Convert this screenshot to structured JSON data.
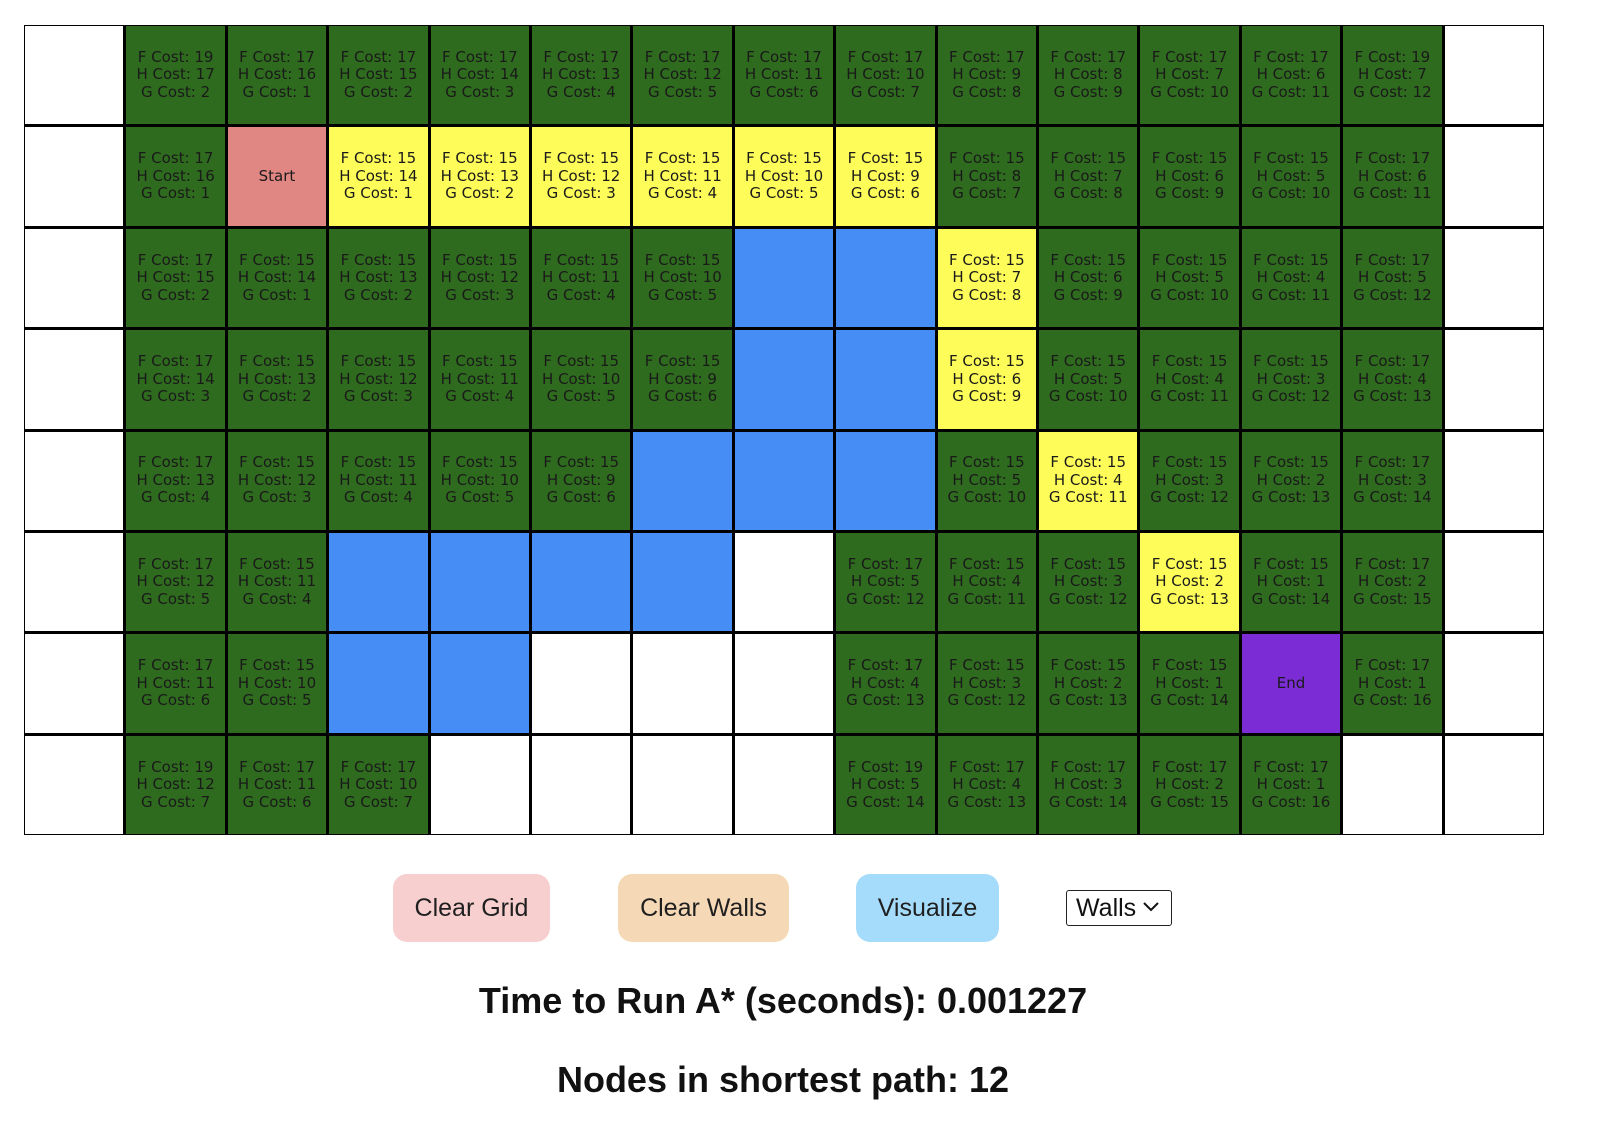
{
  "grid": {
    "rows": [
      [
        {
          "type": "empty"
        },
        {
          "type": "visited",
          "f": 19,
          "h": 17,
          "g": 2
        },
        {
          "type": "visited",
          "f": 17,
          "h": 16,
          "g": 1
        },
        {
          "type": "visited",
          "f": 17,
          "h": 15,
          "g": 2
        },
        {
          "type": "visited",
          "f": 17,
          "h": 14,
          "g": 3
        },
        {
          "type": "visited",
          "f": 17,
          "h": 13,
          "g": 4
        },
        {
          "type": "visited",
          "f": 17,
          "h": 12,
          "g": 5
        },
        {
          "type": "visited",
          "f": 17,
          "h": 11,
          "g": 6
        },
        {
          "type": "visited",
          "f": 17,
          "h": 10,
          "g": 7
        },
        {
          "type": "visited",
          "f": 17,
          "h": 9,
          "g": 8
        },
        {
          "type": "visited",
          "f": 17,
          "h": 8,
          "g": 9
        },
        {
          "type": "visited",
          "f": 17,
          "h": 7,
          "g": 10
        },
        {
          "type": "visited",
          "f": 17,
          "h": 6,
          "g": 11
        },
        {
          "type": "visited",
          "f": 19,
          "h": 7,
          "g": 12
        },
        {
          "type": "empty"
        }
      ],
      [
        {
          "type": "empty"
        },
        {
          "type": "visited",
          "f": 17,
          "h": 16,
          "g": 1
        },
        {
          "type": "start",
          "label": "Start"
        },
        {
          "type": "path",
          "f": 15,
          "h": 14,
          "g": 1
        },
        {
          "type": "path",
          "f": 15,
          "h": 13,
          "g": 2
        },
        {
          "type": "path",
          "f": 15,
          "h": 12,
          "g": 3
        },
        {
          "type": "path",
          "f": 15,
          "h": 11,
          "g": 4
        },
        {
          "type": "path",
          "f": 15,
          "h": 10,
          "g": 5
        },
        {
          "type": "path",
          "f": 15,
          "h": 9,
          "g": 6
        },
        {
          "type": "visited",
          "f": 15,
          "h": 8,
          "g": 7
        },
        {
          "type": "visited",
          "f": 15,
          "h": 7,
          "g": 8
        },
        {
          "type": "visited",
          "f": 15,
          "h": 6,
          "g": 9
        },
        {
          "type": "visited",
          "f": 15,
          "h": 5,
          "g": 10
        },
        {
          "type": "visited",
          "f": 17,
          "h": 6,
          "g": 11
        },
        {
          "type": "empty"
        }
      ],
      [
        {
          "type": "empty"
        },
        {
          "type": "visited",
          "f": 17,
          "h": 15,
          "g": 2
        },
        {
          "type": "visited",
          "f": 15,
          "h": 14,
          "g": 1
        },
        {
          "type": "visited",
          "f": 15,
          "h": 13,
          "g": 2
        },
        {
          "type": "visited",
          "f": 15,
          "h": 12,
          "g": 3
        },
        {
          "type": "visited",
          "f": 15,
          "h": 11,
          "g": 4
        },
        {
          "type": "visited",
          "f": 15,
          "h": 10,
          "g": 5
        },
        {
          "type": "wall"
        },
        {
          "type": "wall"
        },
        {
          "type": "path",
          "f": 15,
          "h": 7,
          "g": 8
        },
        {
          "type": "visited",
          "f": 15,
          "h": 6,
          "g": 9
        },
        {
          "type": "visited",
          "f": 15,
          "h": 5,
          "g": 10
        },
        {
          "type": "visited",
          "f": 15,
          "h": 4,
          "g": 11
        },
        {
          "type": "visited",
          "f": 17,
          "h": 5,
          "g": 12
        },
        {
          "type": "empty"
        }
      ],
      [
        {
          "type": "empty"
        },
        {
          "type": "visited",
          "f": 17,
          "h": 14,
          "g": 3
        },
        {
          "type": "visited",
          "f": 15,
          "h": 13,
          "g": 2
        },
        {
          "type": "visited",
          "f": 15,
          "h": 12,
          "g": 3
        },
        {
          "type": "visited",
          "f": 15,
          "h": 11,
          "g": 4
        },
        {
          "type": "visited",
          "f": 15,
          "h": 10,
          "g": 5
        },
        {
          "type": "visited",
          "f": 15,
          "h": 9,
          "g": 6
        },
        {
          "type": "wall"
        },
        {
          "type": "wall"
        },
        {
          "type": "path",
          "f": 15,
          "h": 6,
          "g": 9
        },
        {
          "type": "visited",
          "f": 15,
          "h": 5,
          "g": 10
        },
        {
          "type": "visited",
          "f": 15,
          "h": 4,
          "g": 11
        },
        {
          "type": "visited",
          "f": 15,
          "h": 3,
          "g": 12
        },
        {
          "type": "visited",
          "f": 17,
          "h": 4,
          "g": 13
        },
        {
          "type": "empty"
        }
      ],
      [
        {
          "type": "empty"
        },
        {
          "type": "visited",
          "f": 17,
          "h": 13,
          "g": 4
        },
        {
          "type": "visited",
          "f": 15,
          "h": 12,
          "g": 3
        },
        {
          "type": "visited",
          "f": 15,
          "h": 11,
          "g": 4
        },
        {
          "type": "visited",
          "f": 15,
          "h": 10,
          "g": 5
        },
        {
          "type": "visited",
          "f": 15,
          "h": 9,
          "g": 6
        },
        {
          "type": "wall"
        },
        {
          "type": "wall"
        },
        {
          "type": "wall"
        },
        {
          "type": "visited",
          "f": 15,
          "h": 5,
          "g": 10
        },
        {
          "type": "path",
          "f": 15,
          "h": 4,
          "g": 11
        },
        {
          "type": "visited",
          "f": 15,
          "h": 3,
          "g": 12
        },
        {
          "type": "visited",
          "f": 15,
          "h": 2,
          "g": 13
        },
        {
          "type": "visited",
          "f": 17,
          "h": 3,
          "g": 14
        },
        {
          "type": "empty"
        }
      ],
      [
        {
          "type": "empty"
        },
        {
          "type": "visited",
          "f": 17,
          "h": 12,
          "g": 5
        },
        {
          "type": "visited",
          "f": 15,
          "h": 11,
          "g": 4
        },
        {
          "type": "wall"
        },
        {
          "type": "wall"
        },
        {
          "type": "wall"
        },
        {
          "type": "wall"
        },
        {
          "type": "empty"
        },
        {
          "type": "visited",
          "f": 17,
          "h": 5,
          "g": 12
        },
        {
          "type": "visited",
          "f": 15,
          "h": 4,
          "g": 11
        },
        {
          "type": "visited",
          "f": 15,
          "h": 3,
          "g": 12
        },
        {
          "type": "path",
          "f": 15,
          "h": 2,
          "g": 13
        },
        {
          "type": "visited",
          "f": 15,
          "h": 1,
          "g": 14
        },
        {
          "type": "visited",
          "f": 17,
          "h": 2,
          "g": 15
        },
        {
          "type": "empty"
        }
      ],
      [
        {
          "type": "empty"
        },
        {
          "type": "visited",
          "f": 17,
          "h": 11,
          "g": 6
        },
        {
          "type": "visited",
          "f": 15,
          "h": 10,
          "g": 5
        },
        {
          "type": "wall"
        },
        {
          "type": "wall"
        },
        {
          "type": "empty"
        },
        {
          "type": "empty"
        },
        {
          "type": "empty"
        },
        {
          "type": "visited",
          "f": 17,
          "h": 4,
          "g": 13
        },
        {
          "type": "visited",
          "f": 15,
          "h": 3,
          "g": 12
        },
        {
          "type": "visited",
          "f": 15,
          "h": 2,
          "g": 13
        },
        {
          "type": "visited",
          "f": 15,
          "h": 1,
          "g": 14
        },
        {
          "type": "end",
          "label": "End"
        },
        {
          "type": "visited",
          "f": 17,
          "h": 1,
          "g": 16
        },
        {
          "type": "empty"
        }
      ],
      [
        {
          "type": "empty"
        },
        {
          "type": "visited",
          "f": 19,
          "h": 12,
          "g": 7
        },
        {
          "type": "visited",
          "f": 17,
          "h": 11,
          "g": 6
        },
        {
          "type": "visited",
          "f": 17,
          "h": 10,
          "g": 7
        },
        {
          "type": "empty"
        },
        {
          "type": "empty"
        },
        {
          "type": "empty"
        },
        {
          "type": "empty"
        },
        {
          "type": "visited",
          "f": 19,
          "h": 5,
          "g": 14
        },
        {
          "type": "visited",
          "f": 17,
          "h": 4,
          "g": 13
        },
        {
          "type": "visited",
          "f": 17,
          "h": 3,
          "g": 14
        },
        {
          "type": "visited",
          "f": 17,
          "h": 2,
          "g": 15
        },
        {
          "type": "visited",
          "f": 17,
          "h": 1,
          "g": 16
        },
        {
          "type": "empty"
        },
        {
          "type": "empty"
        }
      ]
    ],
    "labels": {
      "f": "F Cost:",
      "h": "H Cost:",
      "g": "G Cost:"
    }
  },
  "controls": {
    "clear_grid_label": "Clear Grid",
    "clear_walls_label": "Clear Walls",
    "visualize_label": "Visualize",
    "mode_selected": "Walls"
  },
  "stats": {
    "time_label": "Time to Run A* (seconds): 0.001227",
    "nodes_label": "Nodes in shortest path: 12"
  },
  "colors": {
    "visited": "#2e6b1e",
    "path": "#fdfc58",
    "wall": "#468ef5",
    "start": "#e08683",
    "end": "#7b2cd4",
    "empty": "#ffffff"
  }
}
